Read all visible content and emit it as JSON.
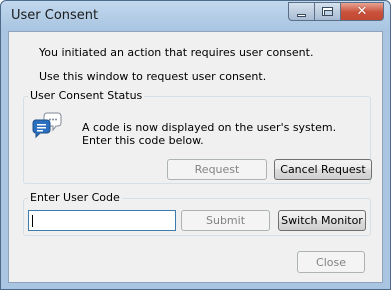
{
  "window": {
    "title": "User Consent"
  },
  "intro": {
    "line1": "You initiated an action that requires user consent.",
    "line2": "Use this window to request user consent."
  },
  "status_group": {
    "legend": "User Consent Status",
    "message_line1": "A code is now displayed on the user's system.",
    "message_line2": "Enter this code below.",
    "icon": "chat-bubbles-icon",
    "request_label": "Request",
    "cancel_request_label": "Cancel Request"
  },
  "code_group": {
    "legend": "Enter User Code",
    "code_value": "",
    "submit_label": "Submit",
    "switch_monitor_label": "Switch Monitor"
  },
  "footer": {
    "close_label": "Close"
  },
  "colors": {
    "frame": "#a9c5e2",
    "client": "#f0f0f0",
    "close_button": "#c9503a",
    "icon_blue": "#2a6fc0"
  }
}
